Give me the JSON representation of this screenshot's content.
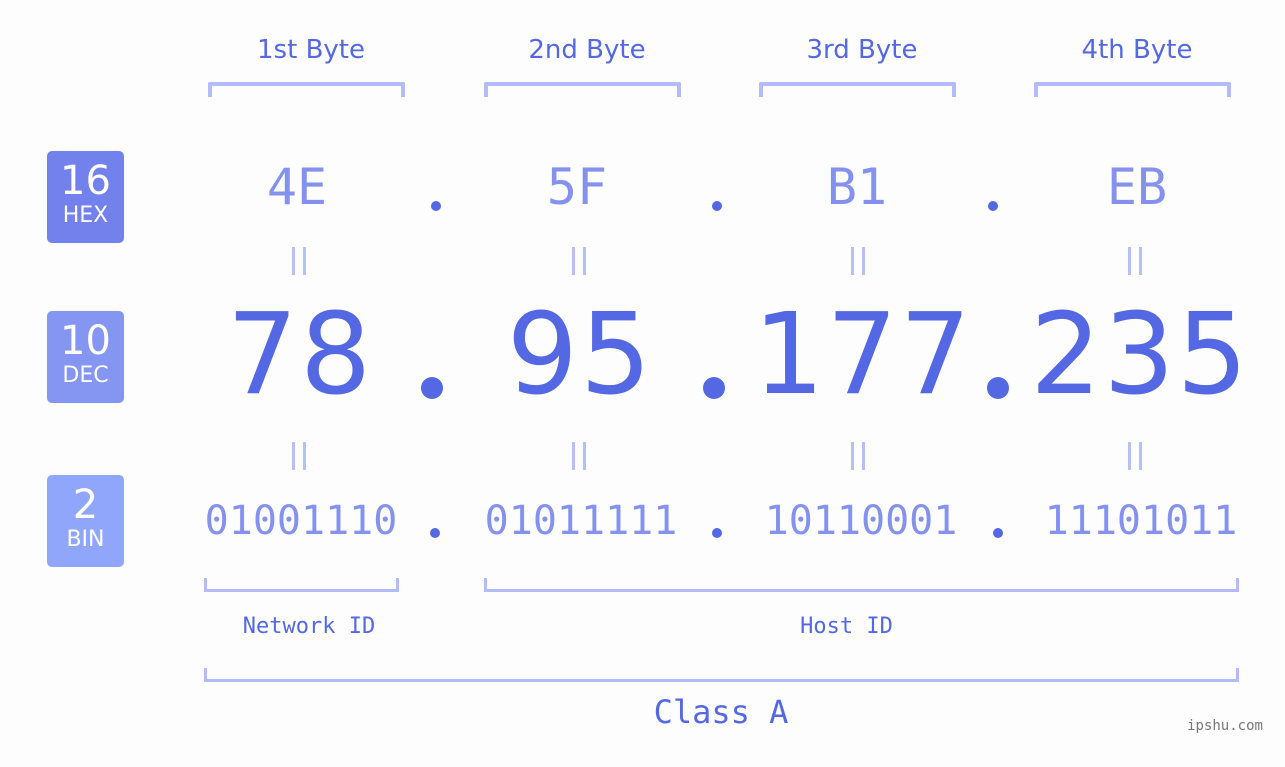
{
  "badges": {
    "hex": {
      "number": "16",
      "label": "HEX",
      "color": "#7281ec"
    },
    "dec": {
      "number": "10",
      "label": "DEC",
      "color": "#8495f2"
    },
    "bin": {
      "number": "2",
      "label": "BIN",
      "color": "#8fa6fb"
    }
  },
  "bytes": [
    {
      "title": "1st Byte",
      "hex": "4E",
      "dec": "78",
      "bin": "01001110"
    },
    {
      "title": "2nd Byte",
      "hex": "5F",
      "dec": "95",
      "bin": "01011111"
    },
    {
      "title": "3rd Byte",
      "hex": "B1",
      "dec": "177",
      "bin": "10110001"
    },
    {
      "title": "4th Byte",
      "hex": "EB",
      "dec": "235",
      "bin": "11101011"
    }
  ],
  "separator": ".",
  "network_id_label": "Network ID",
  "host_id_label": "Host ID",
  "class_label": "Class A",
  "watermark": "ipshu.com",
  "colors": {
    "accent": "#5468e4",
    "light_value": "#8591ef",
    "bracket": "#b3bcf8",
    "background": "#fcfdfc"
  }
}
